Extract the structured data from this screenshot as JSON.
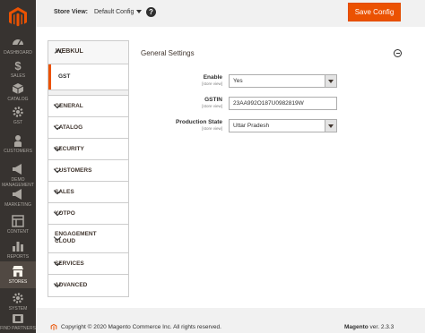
{
  "colors": {
    "accent": "#eb5202",
    "nav_bg": "#373330",
    "nav_active": "#514943"
  },
  "nav": {
    "items": [
      {
        "label": "Dashboard",
        "icon": "dashboard-icon"
      },
      {
        "label": "Sales",
        "icon": "dollar-icon"
      },
      {
        "label": "Catalog",
        "icon": "cube-icon"
      },
      {
        "label": "GST",
        "icon": "gear-icon"
      },
      {
        "label": "Customers",
        "icon": "user-icon"
      },
      {
        "label": "Demo Management",
        "icon": "megaphone-icon"
      },
      {
        "label": "Marketing",
        "icon": "megaphone-icon"
      },
      {
        "label": "Content",
        "icon": "layout-icon"
      },
      {
        "label": "Reports",
        "icon": "bar-chart-icon"
      },
      {
        "label": "Stores",
        "icon": "store-icon"
      },
      {
        "label": "System",
        "icon": "gear-icon"
      },
      {
        "label": "Find Partners",
        "icon": "partners-icon"
      }
    ],
    "active": "Stores"
  },
  "header": {
    "store_view_label": "Store View:",
    "store_view_value": "Default Config",
    "help": "?",
    "save_label": "Save Config"
  },
  "tabs": {
    "group": "WEBKUL",
    "sub_item": "GST",
    "sections": [
      "GENERAL",
      "CATALOG",
      "SECURITY",
      "CUSTOMERS",
      "SALES",
      "YOTPO",
      "ENGAGEMENT CLOUD",
      "SERVICES",
      "ADVANCED"
    ]
  },
  "settings": {
    "title": "General Settings",
    "fields": [
      {
        "label": "Enable",
        "scope": "[store view]",
        "value": "Yes",
        "type": "select"
      },
      {
        "label": "GSTIN",
        "scope": "[store view]",
        "value": "23AA992O187U0982819W",
        "type": "text"
      },
      {
        "label": "Production State",
        "scope": "[store view]",
        "value": "Uttar Pradesh",
        "type": "select"
      }
    ]
  },
  "footer": {
    "copyright": "Copyright © 2020 Magento Commerce Inc. All rights reserved.",
    "brand": "Magento",
    "version": " ver. 2.3.3"
  }
}
